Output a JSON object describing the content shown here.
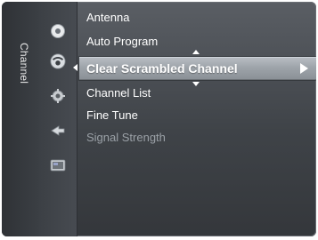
{
  "side_tab": {
    "label": "Channel"
  },
  "icons": [
    "antenna-icon",
    "channel-icon",
    "setup-icon",
    "input-icon",
    "application-icon"
  ],
  "menu": {
    "items": [
      {
        "label": "Antenna"
      },
      {
        "label": "Auto Program"
      },
      {
        "label": "Clear Scrambled Channel",
        "selected": true
      },
      {
        "label": "Channel List"
      },
      {
        "label": "Fine Tune"
      },
      {
        "label": "Signal Strength",
        "disabled": true
      }
    ]
  },
  "colors": {
    "panel": "#45494e",
    "highlight": "#9ea4aa",
    "text": "#ffffff",
    "disabled_text": "#9aa0a6"
  }
}
